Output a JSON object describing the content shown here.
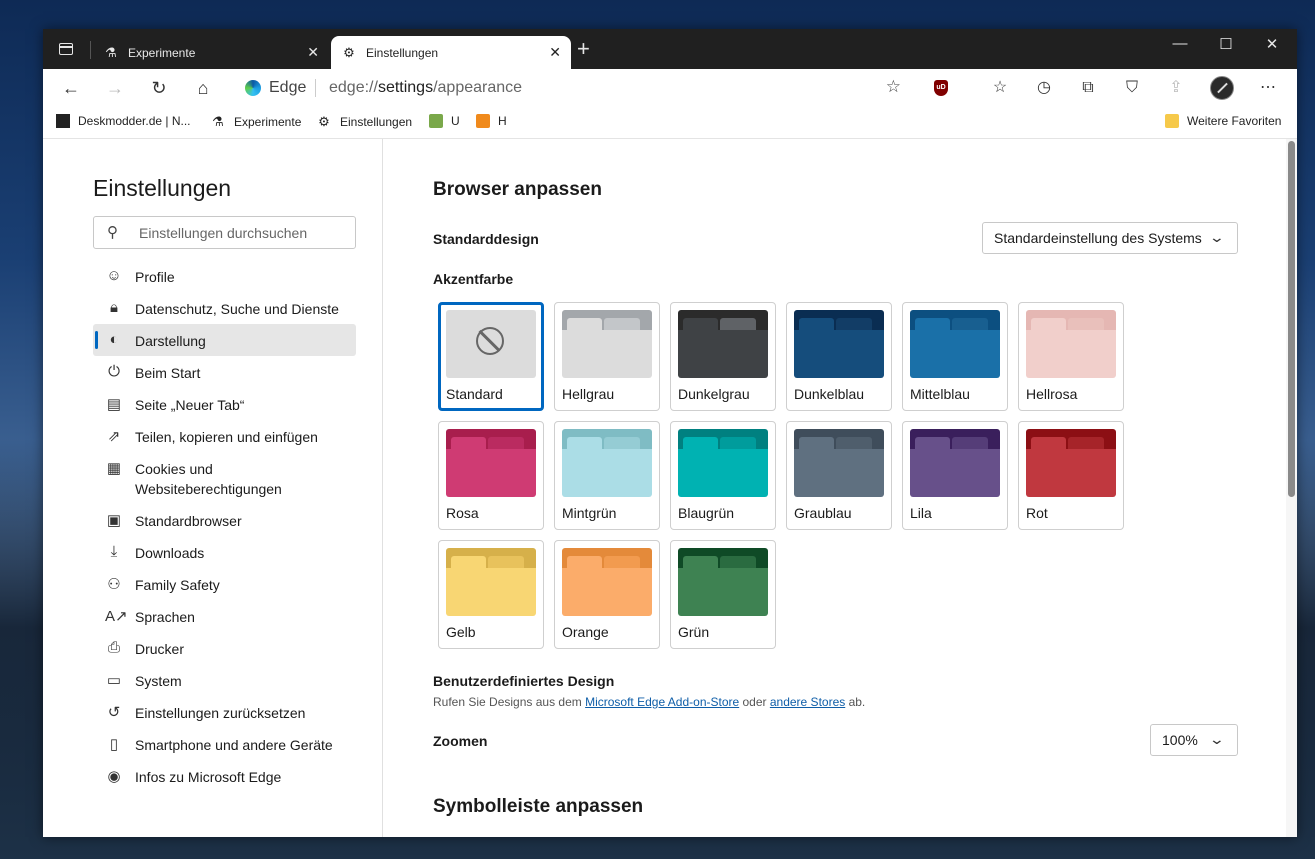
{
  "tabs": [
    {
      "label": "Experimente",
      "icon": "flask-icon"
    },
    {
      "label": "Einstellungen",
      "icon": "gear-icon"
    }
  ],
  "toolbar": {
    "address_brand": "Edge",
    "url_prefix": "edge://",
    "url_host": "settings",
    "url_path": "/appearance"
  },
  "favorites": [
    {
      "label": "Deskmodder.de | N...",
      "icon": "deskmodder-icon"
    },
    {
      "label": "Experimente",
      "icon": "flask-icon"
    },
    {
      "label": "Einstellungen",
      "icon": "gear-icon"
    },
    {
      "label": "U",
      "icon": "extension-u-icon"
    },
    {
      "label": "H",
      "icon": "extension-h-icon"
    },
    {
      "label": "Weitere Favoriten",
      "icon": "folder-icon"
    }
  ],
  "sidebar": {
    "title": "Einstellungen",
    "search_placeholder": "Einstellungen durchsuchen",
    "items": [
      {
        "label": "Profile",
        "icon": "person-icon"
      },
      {
        "label": "Datenschutz, Suche und Dienste",
        "icon": "lock-icon"
      },
      {
        "label": "Darstellung",
        "icon": "palette-icon",
        "selected": true
      },
      {
        "label": "Beim Start",
        "icon": "power-icon"
      },
      {
        "label": "Seite „Neuer Tab“",
        "icon": "newtab-icon"
      },
      {
        "label": "Teilen, kopieren und einfügen",
        "icon": "share-icon"
      },
      {
        "label": "Cookies und Websiteberechtigungen",
        "icon": "cookie-icon"
      },
      {
        "label": "Standardbrowser",
        "icon": "browser-icon"
      },
      {
        "label": "Downloads",
        "icon": "download-icon"
      },
      {
        "label": "Family Safety",
        "icon": "family-icon"
      },
      {
        "label": "Sprachen",
        "icon": "language-icon"
      },
      {
        "label": "Drucker",
        "icon": "printer-icon"
      },
      {
        "label": "System",
        "icon": "laptop-icon"
      },
      {
        "label": "Einstellungen zurücksetzen",
        "icon": "reset-icon"
      },
      {
        "label": "Smartphone und andere Geräte",
        "icon": "phone-icon"
      },
      {
        "label": "Infos zu Microsoft Edge",
        "icon": "edge-icon"
      }
    ]
  },
  "main": {
    "heading": "Browser anpassen",
    "theme_label": "Standarddesign",
    "theme_value": "Standardeinstellung des Systems",
    "accent_label": "Akzentfarbe",
    "colors": [
      {
        "label": "Standard",
        "selected": true
      },
      {
        "label": "Hellgrau",
        "top": "#a3a7ab",
        "tab": "#dcdcdc",
        "tab2": "#c3c6c9",
        "body": "#dcdcdc"
      },
      {
        "label": "Dunkelgrau",
        "top": "#2b2b2b",
        "tab": "#3f4245",
        "tab2": "#5f6266",
        "body": "#3f4245"
      },
      {
        "label": "Dunkelblau",
        "top": "#0a2d52",
        "tab": "#154d7c",
        "tab2": "#123d66",
        "body": "#154d7c"
      },
      {
        "label": "Mittelblau",
        "top": "#0c4f80",
        "tab": "#1a70a8",
        "tab2": "#185f90",
        "body": "#1a70a8"
      },
      {
        "label": "Hellrosa",
        "top": "#e5b7b3",
        "tab": "#f1cfcb",
        "tab2": "#e9c0bb",
        "body": "#f1cfcb"
      },
      {
        "label": "Rosa",
        "top": "#a81e4d",
        "tab": "#cf3b73",
        "tab2": "#ba2b60",
        "body": "#cf3b73"
      },
      {
        "label": "Mintgrün",
        "top": "#7fbcc4",
        "tab": "#abdde6",
        "tab2": "#95ccd4",
        "body": "#abdde6"
      },
      {
        "label": "Blaugrün",
        "top": "#008080",
        "tab": "#00b2b2",
        "tab2": "#009c9c",
        "body": "#00b2b2"
      },
      {
        "label": "Graublau",
        "top": "#3f4d5b",
        "tab": "#5f7080",
        "tab2": "#4f5e6c",
        "body": "#5f7080"
      },
      {
        "label": "Lila",
        "top": "#3a1f5c",
        "tab": "#67508a",
        "tab2": "#553d78",
        "body": "#67508a"
      },
      {
        "label": "Rot",
        "top": "#8c0f14",
        "tab": "#c0383f",
        "tab2": "#a62429",
        "body": "#c0383f"
      },
      {
        "label": "Gelb",
        "top": "#d6b04a",
        "tab": "#f8d673",
        "tab2": "#e8c25c",
        "body": "#f8d673"
      },
      {
        "label": "Orange",
        "top": "#e48a3a",
        "tab": "#fbac6a",
        "tab2": "#f29b4f",
        "body": "#fbac6a"
      },
      {
        "label": "Grün",
        "top": "#0f4a26",
        "tab": "#3e8252",
        "tab2": "#2a6b40",
        "body": "#3e8252"
      }
    ],
    "custom_label": "Benutzerdefiniertes Design",
    "custom_text_1": "Rufen Sie Designs aus dem ",
    "custom_link_1": "Microsoft Edge Add-on-Store",
    "custom_text_2": " oder ",
    "custom_link_2": "andere Stores",
    "custom_text_3": " ab.",
    "zoom_label": "Zoomen",
    "zoom_value": "100%",
    "heading2": "Symbolleiste anpassen"
  }
}
